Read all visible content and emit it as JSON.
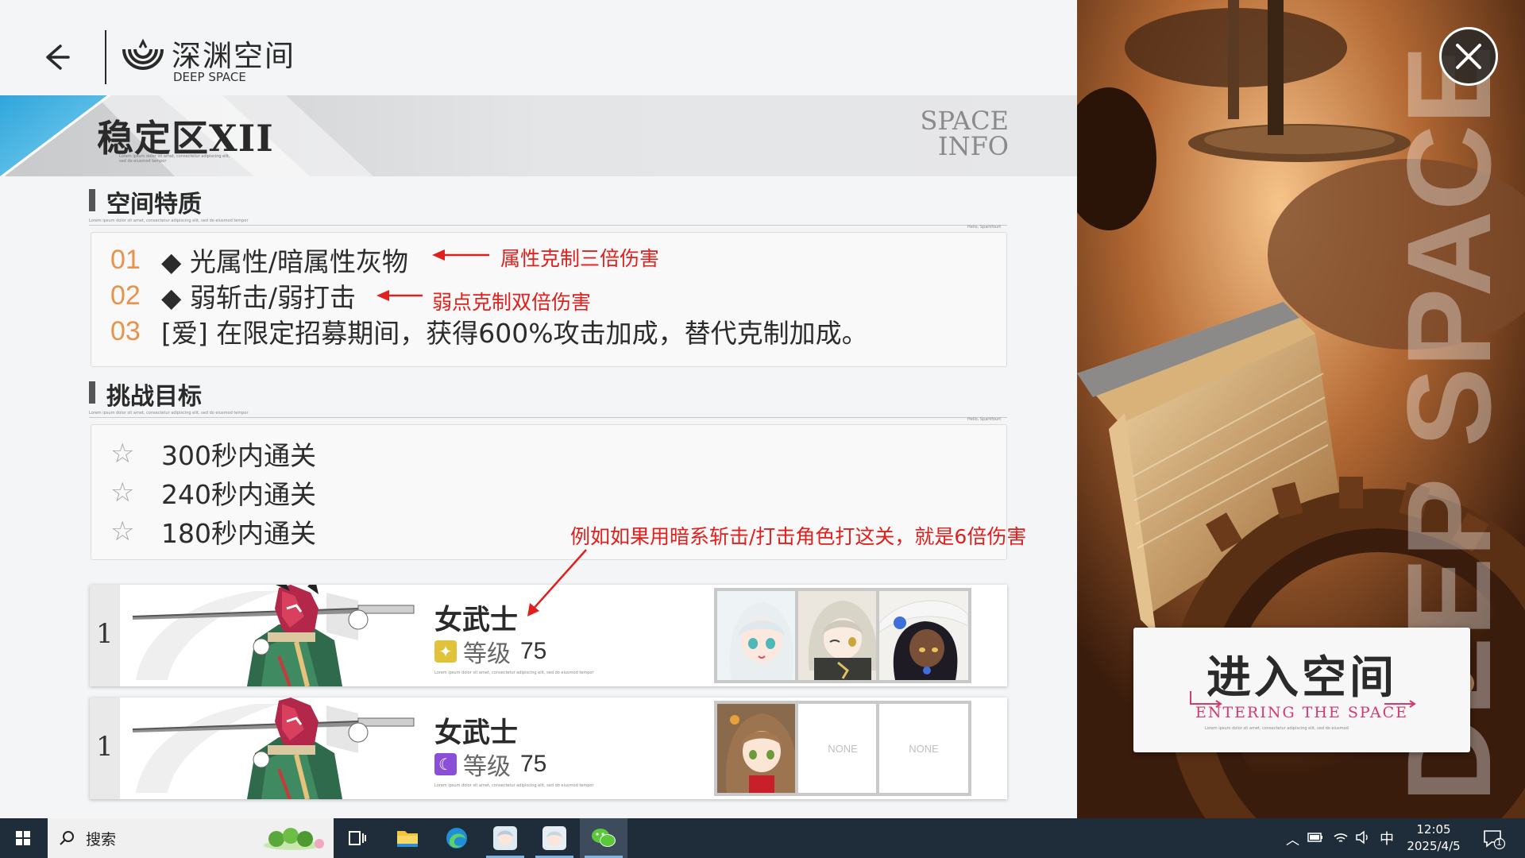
{
  "header": {
    "title": "深渊空间",
    "subtitle": "DEEP SPACE"
  },
  "banner": {
    "zone_title": "稳定区XII",
    "space_info_line1": "SPACE",
    "space_info_line2": "INFO",
    "fine_print": "Lorem ipsum dolor sit amet, consectetur adipiscing elit, sed do eiusmod tempor"
  },
  "traits": {
    "title": "空间特质",
    "fine_print": "Lorem ipsum dolor sit amet, consectetur adipiscing elit, sed do eiusmod tempor",
    "fine_print_right": "Hello, Sparkfourt",
    "items": [
      {
        "num": "01",
        "text": "◆ 光属性/暗属性灰物"
      },
      {
        "num": "02",
        "text": "◆ 弱斩击/弱打击"
      },
      {
        "num": "03",
        "text": "[爱] 在限定招募期间，获得600%攻击加成，替代克制加成。"
      }
    ]
  },
  "goals": {
    "title": "挑战目标",
    "fine_print": "Lorem ipsum dolor sit amet, consectetur adipiscing elit, sed do eiusmod tempor",
    "fine_print_right": "Hello, Sparkfourt",
    "items": [
      {
        "star": "☆",
        "text": "300秒内通关"
      },
      {
        "star": "☆",
        "text": "240秒内通关"
      },
      {
        "star": "☆",
        "text": "180秒内通关"
      }
    ]
  },
  "annotations": {
    "a1": "属性克制三倍伤害",
    "a2": "弱点克制双倍伤害",
    "a3": "例如如果用暗系斩击/打击角色打这关，就是6倍伤害"
  },
  "teams": [
    {
      "num": "1",
      "boss_name": "女武士",
      "level_label": "等级",
      "level_value": "75",
      "level_icon": "light-element-icon",
      "level_color": "#e2c23a",
      "fine_print": "Lorem ipsum dolor sit amet, consectetur adipiscing elit, sed do eiusmod tempor",
      "slots": [
        "portrait-white-hair",
        "portrait-silver-hair",
        "portrait-dark-hat"
      ]
    },
    {
      "num": "1",
      "boss_name": "女武士",
      "level_label": "等级",
      "level_value": "75",
      "level_icon": "dark-element-icon",
      "level_color": "#8a4fd6",
      "fine_print": "Lorem ipsum dolor sit amet, consectetur adipiscing elit, sed do eiusmod tempor",
      "slots": [
        "portrait-brown-hair",
        "NONE",
        "NONE"
      ]
    }
  ],
  "enter": {
    "title": "进入空间",
    "subtitle": "ENTERING THE SPACE",
    "fine_print": "Lorem ipsum dolor sit amet, consectetur adipiscing elit, sed do eiusmod"
  },
  "background_text": "DEEP SPACE",
  "taskbar": {
    "search_label": "搜索",
    "ime": "中",
    "time": "12:05",
    "date": "2025/4/5",
    "notification_count": "1"
  }
}
